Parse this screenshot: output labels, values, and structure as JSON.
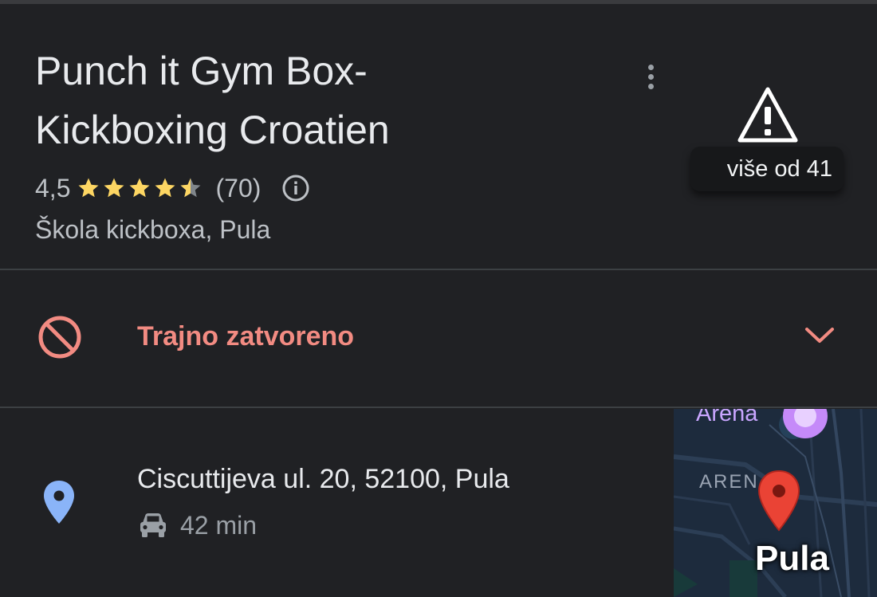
{
  "place": {
    "title_line1": "Punch it Gym Box-",
    "title_line2": "Kickboxing Croatien",
    "rating": "4,5",
    "stars": 4.5,
    "review_count": "(70)",
    "category": "Škola kickboxa, Pula"
  },
  "header": {
    "more_icon": "more-vert-icon",
    "warning_icon": "warning-triangle-icon",
    "warning_chip_label": "više od 41"
  },
  "status": {
    "icon": "no-entry-icon",
    "label": "Trajno zatvoreno",
    "chevron_icon": "chevron-down-icon"
  },
  "address": {
    "icon": "location-pin-icon",
    "text": "Ciscuttijeva ul. 20, 52100, Pula",
    "travel_icon": "car-icon",
    "travel_time": "42 min"
  },
  "map": {
    "label_arena": "Arena",
    "label_arena2": "AREN",
    "label_city": "Pula",
    "marker_icon": "red-map-marker-icon",
    "poi_icon": "purple-poi-icon"
  },
  "colors": {
    "background": "#202124",
    "text_primary": "#e8eaed",
    "text_secondary": "#bdc1c6",
    "star": "#fdd663",
    "closed": "#f28b82",
    "pin": "#8ab4f8",
    "map_marker": "#ea4335"
  }
}
